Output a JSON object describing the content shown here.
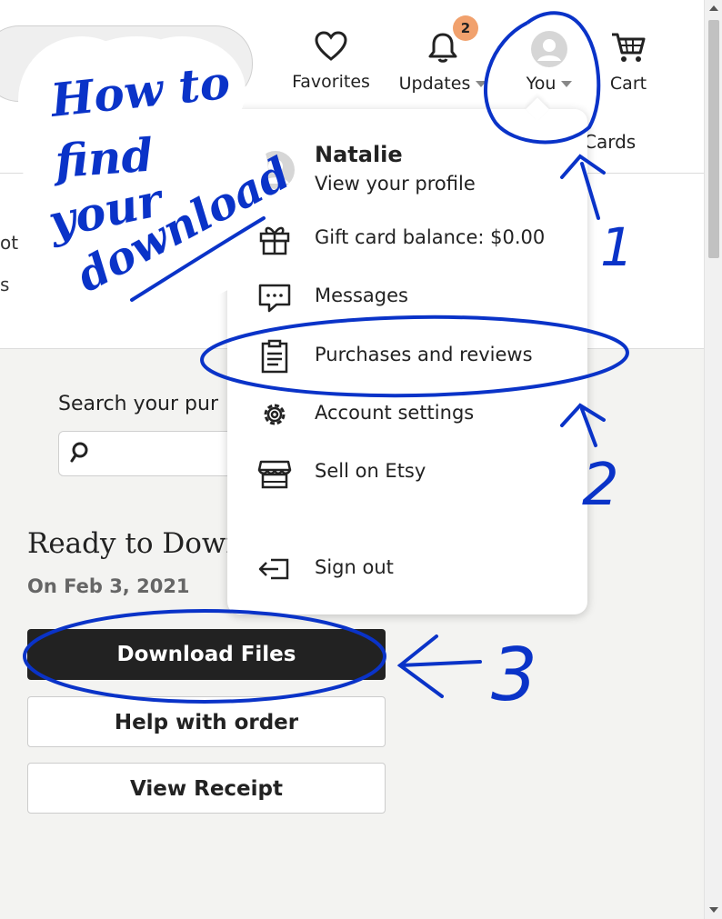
{
  "header": {
    "nav": {
      "favorites": "Favorites",
      "updates": "Updates",
      "updates_badge": "2",
      "you": "You",
      "cart": "Cart",
      "cards_fragment": "Cards"
    }
  },
  "background": {
    "fragment_1": "ot",
    "fragment_2": "s",
    "search_label": "Search your pur",
    "ready_title": "Ready to Dowr",
    "ready_date": "On Feb 3, 2021",
    "buttons": {
      "download": "Download Files",
      "help": "Help with order",
      "receipt": "View Receipt"
    }
  },
  "dropdown": {
    "profile_name": "Natalie",
    "profile_sub": "View your profile",
    "items": [
      {
        "label": "Gift card balance: $0.00",
        "icon": "gift-icon"
      },
      {
        "label": "Messages",
        "icon": "message-icon"
      },
      {
        "label": "Purchases and reviews",
        "icon": "clipboard-icon"
      },
      {
        "label": "Account settings",
        "icon": "gear-icon"
      },
      {
        "label": "Sell on Etsy",
        "icon": "shop-icon"
      },
      {
        "label": "Sign out",
        "icon": "sign-out-icon"
      }
    ]
  },
  "annotation": {
    "title_line1": "How to",
    "title_line2": "find",
    "title_line3": "your",
    "title_line4": "download",
    "step1": "1",
    "step2": "2",
    "step3": "3",
    "ink_color": "#0a33c8"
  }
}
